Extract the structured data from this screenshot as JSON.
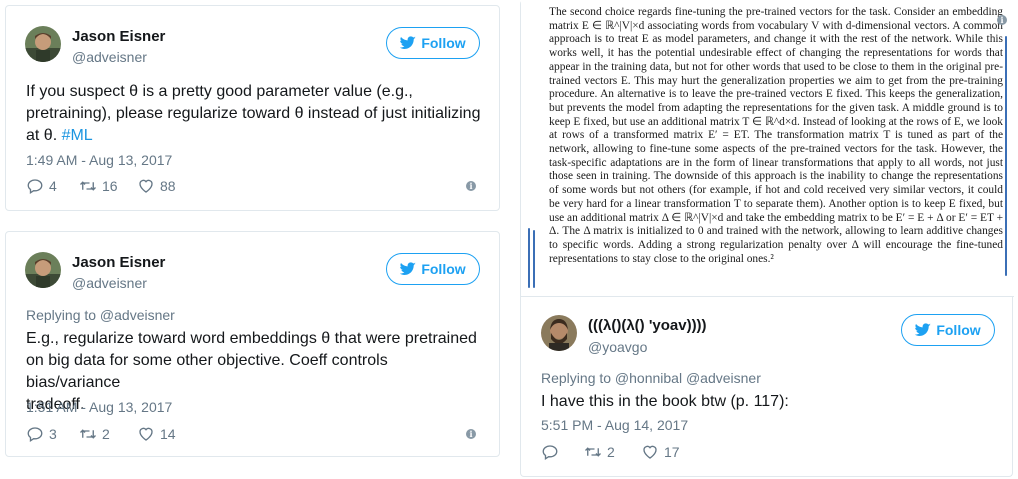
{
  "tweets": [
    {
      "name": "Jason Eisner",
      "handle": "@adveisner",
      "follow_label": "Follow",
      "text_lines": [
        "If you suspect θ is a pretty good parameter value (e.g.,",
        "pretraining), please regularize toward θ instead of just initializing"
      ],
      "text_tail": "at θ. ",
      "hashtag": "#ML",
      "timestamp": "1:49 AM - Aug 13, 2017",
      "replies": "4",
      "retweets": "16",
      "likes": "88"
    },
    {
      "name": "Jason Eisner",
      "handle": "@adveisner",
      "follow_label": "Follow",
      "replying_to": "Replying to @adveisner",
      "text_lines": [
        "E.g., regularize toward word embeddings θ that were pretrained",
        "on big data for some other objective. Coeff controls bias/variance",
        "tradeoff."
      ],
      "timestamp": "1:51 AM - Aug 13, 2017",
      "replies": "3",
      "retweets": "2",
      "likes": "14"
    },
    {
      "name": "(((λ()(λ() 'yoav))))",
      "handle": "@yoavgo",
      "follow_label": "Follow",
      "replying_to": "Replying to @honnibal @adveisner",
      "text_lines": [
        "I have this in the book btw (p. 117):"
      ],
      "timestamp": "5:51 PM - Aug 14, 2017",
      "replies": "",
      "retweets": "2",
      "likes": "17"
    }
  ],
  "book_excerpt": [
    "The second choice regards fine-tuning the pre-trained vectors for the task. Consider an embedding matrix E ∈ ℝ^|V|×d associating words from vocabulary V with d-dimensional vectors. A common approach is to treat E as model parameters, and change it with the rest of the network. While this works well, it has the potential undesirable effect of changing the representations for words that appear in the training data, but not for other words that used to be close to them in the original pre-trained vectors E. This may hurt the generalization properties we aim to get from the pre-training procedure. An alternative is to leave the pre-trained vectors E fixed. This keeps the generalization, but prevents the model from adapting the representations for the given task. A middle ground is to keep E fixed, but use an additional matrix T ∈ ℝ^d×d. Instead of looking at the rows of E, we look at rows of a transformed matrix E′ = ET. The transformation matrix T is tuned as part of the network, allowing to fine-tune some aspects of the pre-trained vectors for the task. However, the task-specific adaptations are in the form of linear transformations that apply to all words, not just those seen in training. The downside of this approach is the inability to change the representations of some words but not others (for example, if hot and cold received very similar vectors, it could be very hard for a linear transformation T to separate them). Another option is to keep E fixed, but use an additional matrix Δ ∈ ℝ^|V|×d and take the embedding matrix to be E′ = E + Δ or E′ = ET + Δ. The Δ matrix is initialized to 0 and trained with the network, allowing to learn additive changes to specific words. Adding a strong regularization penalty over Δ will encourage the fine-tuned representations to stay close to the original ones.²"
  ],
  "icons": {
    "follow": "twitter-bird-icon",
    "reply": "reply-icon",
    "retweet": "retweet-icon",
    "like": "heart-icon",
    "info": "info-icon"
  },
  "colors": {
    "accent": "#1da1f2",
    "hashtag": "#1b95e0",
    "secondary_text": "#657786",
    "border": "#e1e8ed",
    "book_marker": "#3b6fb6"
  }
}
